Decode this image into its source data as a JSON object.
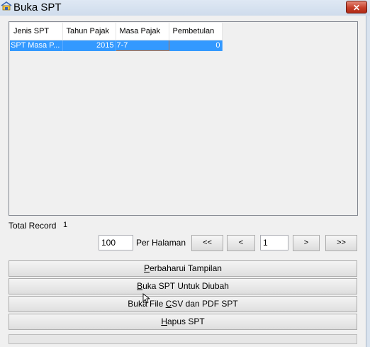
{
  "window": {
    "title": "Buka SPT",
    "close_glyph": "✕",
    "app_icon": "application-icon"
  },
  "table": {
    "columns": [
      "Jenis SPT",
      "Tahun Pajak",
      "Masa Pajak",
      "Pembetulan"
    ],
    "rows": [
      {
        "jenis_spt": "SPT Masa P...",
        "tahun_pajak": "2015",
        "masa_pajak": "7-7",
        "pembetulan": "0",
        "selected": true
      }
    ]
  },
  "footer": {
    "total_label": "Total Record",
    "total_value": "1"
  },
  "paging": {
    "per_page_value": "100",
    "per_page_label": "Per Halaman",
    "first": "<<",
    "prev": "<",
    "page_value": "1",
    "next": ">",
    "last": ">>"
  },
  "actions": {
    "refresh": {
      "mnemonic": "P",
      "rest": "erbaharui Tampilan"
    },
    "open_edit": {
      "mnemonic": "B",
      "rest": "uka SPT Untuk Diubah"
    },
    "open_csv": {
      "before": "Buka File ",
      "mnemonic": "C",
      "after": "SV dan PDF SPT"
    },
    "delete": {
      "mnemonic": "H",
      "rest": "apus SPT"
    }
  },
  "colors": {
    "selection": "#3399ff",
    "close_button": "#c7402b"
  }
}
